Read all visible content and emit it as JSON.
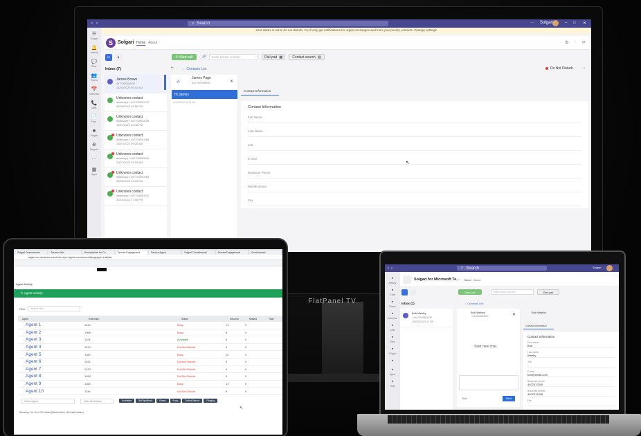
{
  "monitor": {
    "brand": "FlatPanel TV",
    "search": "Search",
    "user": "Solgari",
    "notice": "Your status is set to do not disturb. You'll only get notifications for urgent messages and from your priority contacts. Change settings",
    "app": {
      "name": "Solgari",
      "tab_home": "Home",
      "tab_about": "About"
    },
    "rail": [
      {
        "icon": "☰",
        "label": "Solgari"
      },
      {
        "icon": "🔔",
        "label": "Activity"
      },
      {
        "icon": "💬",
        "label": "Chat"
      },
      {
        "icon": "👥",
        "label": "Teams"
      },
      {
        "icon": "📅",
        "label": "Calendar"
      },
      {
        "icon": "📞",
        "label": "Calls"
      },
      {
        "icon": "📄",
        "label": "Files"
      },
      {
        "icon": "■",
        "label": "Solgari"
      },
      {
        "icon": "⊕",
        "label": "Support"
      },
      {
        "icon": "···",
        "label": ""
      },
      {
        "icon": "▦",
        "label": "Apps"
      }
    ],
    "toolbar": {
      "start_call": "Start call",
      "number_placeholder": "Enter phone number",
      "dial_pad": "Dial pad",
      "contact_search": "Contact search"
    },
    "status": "Do Not Disturb",
    "inbox_title": "Inbox (7)",
    "contacts_link": "Contacts List",
    "inbox": [
      {
        "name": "James Brown",
        "num": "447700900000",
        "time": "16/02/2023 09:02 AM",
        "type": "blue"
      },
      {
        "name": "Unknown contact",
        "num": "whatsapp:+447700900172",
        "time": "05/08/2022 15:56 PM",
        "type": "green"
      },
      {
        "name": "Unknown contact",
        "num": "whatsapp:+447700900035",
        "time": "15/07/2022 15:48 PM",
        "type": "green"
      },
      {
        "name": "Unknown contact",
        "num": "whatsapp:+447700900088",
        "time": "13/07/2022 09:26 AM",
        "type": "red"
      },
      {
        "name": "Unknown contact",
        "num": "whatsapp:+447700900090",
        "time": "20/07/2022 04:04 AM",
        "type": "red"
      },
      {
        "name": "Unknown contact",
        "num": "whatsapp:+447700900064",
        "time": "29/06/2022 14:04 PM",
        "type": "red"
      },
      {
        "name": "Unknown contact",
        "num": "whatsapp:+447700900037",
        "time": "30/10/2022 17:06 PM",
        "type": "red"
      }
    ],
    "conversation": {
      "name": "James Page",
      "num": "447700900000",
      "bubble": "Hi James",
      "ts": "16/02/2023 09:09 AM"
    },
    "contact_tab": "Contact Information",
    "contact_title": "Contact Information",
    "fields": [
      "Full Name",
      "Last Name",
      "Job",
      "E-mail",
      "Business Phone",
      "Mobile phone",
      "Fax"
    ]
  },
  "tablet": {
    "tabs": [
      "Solgari Omnichannel",
      "Service Hub",
      "Omnichannel for Cu",
      "Service Engagement",
      "Service Agent",
      "Solgari Omnichannel",
      "Service Engagement",
      "Omnichannel"
    ],
    "address": "solgari.crm.dynamics.com/main.aspx?appid=omnichannel&pagetype=entitylist",
    "page_title": "Agent Activity",
    "banner": "Agent Activity",
    "filter_label": "Filter",
    "filter_placeholder": "Search filter...",
    "columns": [
      "Agent",
      "Extension",
      "Status",
      "Inbound",
      "Missed",
      "Total"
    ],
    "agents": [
      {
        "name": "Agent 1",
        "ext": "1142",
        "status": "Busy",
        "color": "#e53935",
        "n1": "14",
        "n2": "0"
      },
      {
        "name": "Agent 2",
        "ext": "1068",
        "status": "Busy",
        "color": "#e53935",
        "n1": "8",
        "n2": "0"
      },
      {
        "name": "Agent 3",
        "ext": "1021",
        "status": "Available",
        "color": "#2e7d32",
        "n1": "6",
        "n2": "0"
      },
      {
        "name": "Agent 4",
        "ext": "1143",
        "status": "Do Not Disturb",
        "color": "#e53935",
        "n1": "9",
        "n2": "0"
      },
      {
        "name": "Agent 5",
        "ext": "1166",
        "status": "Busy",
        "color": "#e53935",
        "n1": "12",
        "n2": "0"
      },
      {
        "name": "Agent 6",
        "ext": "1031",
        "status": "Do Not Disturb",
        "color": "#e53935",
        "n1": "0",
        "n2": "0"
      },
      {
        "name": "Agent 7",
        "ext": "1070",
        "status": "Do Not Disturb",
        "color": "#e53935",
        "n1": "6",
        "n2": "0"
      },
      {
        "name": "Agent 8",
        "ext": "1063",
        "status": "Do Not Disturb",
        "color": "#e53935",
        "n1": "6",
        "n2": "0"
      },
      {
        "name": "Agent 9",
        "ext": "1166",
        "status": "Busy",
        "color": "#e53935",
        "n1": "14",
        "n2": "0"
      },
      {
        "name": "Agent 10",
        "ext": "1146",
        "status": "Do Not Disturb",
        "color": "#e53935",
        "n1": "8",
        "n2": "0"
      }
    ],
    "agent_filter": "Select Agent",
    "ext_filter": "Select Extension",
    "badges": [
      "Available",
      "BeRightBack",
      "Break",
      "Busy",
      "DoNotDisturb",
      "Ringing"
    ],
    "footer": "Showing 1 to 10 of 10 entries (filtered from 118 total entries)"
  },
  "laptop": {
    "search": "Search",
    "user": "Solgari",
    "app": "Solgari for Microsoft Te...",
    "tab_home": "Home",
    "tab_about": "About",
    "start_call": "Start call",
    "number_placeholder": "Enter phone number",
    "dial_pad": "Dial pad",
    "inbox_title": "Inbox (1)",
    "contacts_link": "Contacts List",
    "item": {
      "name": "Bob Webby",
      "num": "+441234560000",
      "time": "16/02/2023 17:00"
    },
    "chat_name": "Bob Webby",
    "chat_num": "+441234560000",
    "start_chat": "Start new chat",
    "end": "End",
    "send": "Send",
    "contact_tab": "Contact Information",
    "contact_title": "Contact Information",
    "fields": [
      {
        "label": "First name",
        "value": "Bob"
      },
      {
        "label": "Last name",
        "value": "Webby"
      },
      {
        "label": "Job",
        "value": "-"
      },
      {
        "label": "E-mail",
        "value": "bob@nmail.com"
      },
      {
        "label": "Business phone",
        "value": "4402012345"
      },
      {
        "label": "Business Mobile",
        "value": "4402012345"
      },
      {
        "label": "Fax",
        "value": ""
      }
    ],
    "rail": [
      "Activity",
      "Chat",
      "Teams",
      "Calendar",
      "Calls",
      "Files",
      "Solgari",
      "",
      "Apps",
      "Help"
    ]
  }
}
